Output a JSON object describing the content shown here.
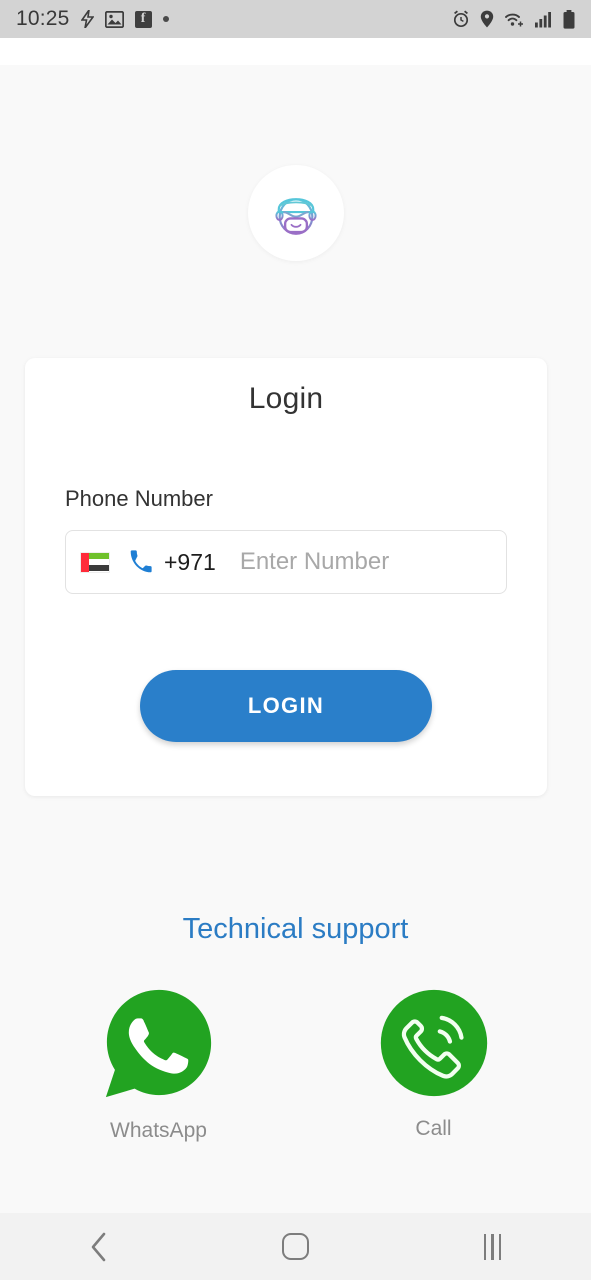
{
  "status_bar": {
    "time": "10:25",
    "left_icons": [
      "bolt-icon",
      "image-icon",
      "facebook-icon",
      "dot-icon"
    ],
    "right_icons": [
      "alarm-icon",
      "location-icon",
      "wifi-icon",
      "signal-icon",
      "battery-icon"
    ]
  },
  "logo": {
    "name": "app-avatar-logo",
    "cap_color": "#5fc8d8",
    "beard_color": "#9b6fc4"
  },
  "card": {
    "title": "Login",
    "phone_label": "Phone Number",
    "country_code": "+971",
    "country_flag": "uae-flag",
    "number_placeholder": "Enter Number",
    "number_value": "",
    "login_label": "LOGIN",
    "login_color": "#2a7fca"
  },
  "support": {
    "title": "Technical support",
    "title_color": "#2b7cc4",
    "items": [
      {
        "label": "WhatsApp",
        "icon": "whatsapp-icon",
        "color": "#22a321"
      },
      {
        "label": "Call",
        "icon": "call-icon",
        "color": "#22a321"
      }
    ]
  },
  "nav_bar": {
    "back": "back-icon",
    "home": "home-icon",
    "recents": "recents-icon"
  }
}
